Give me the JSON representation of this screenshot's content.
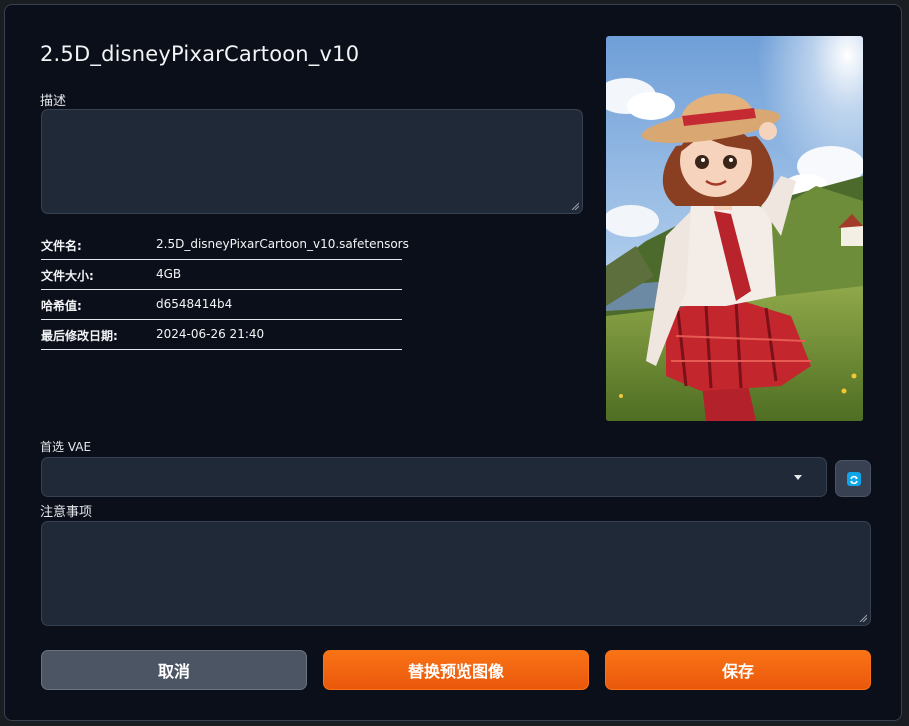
{
  "dialog": {
    "title": "2.5D_disneyPixarCartoon_v10",
    "description_label": "描述",
    "description_value": "",
    "info": [
      {
        "key": "文件名:",
        "value": "2.5D_disneyPixarCartoon_v10.safetensors"
      },
      {
        "key": "文件大小:",
        "value": "4GB"
      },
      {
        "key": "哈希值:",
        "value": "d6548414b4"
      },
      {
        "key": "最后修改日期:",
        "value": "2024-06-26 21:40"
      }
    ],
    "vae_label": "首选 VAE",
    "vae_value": "",
    "notes_label": "注意事项",
    "notes_value": "",
    "buttons": {
      "cancel": "取消",
      "replace_preview": "替换预览图像",
      "save": "保存"
    }
  },
  "colors": {
    "background": "#0b0f19",
    "field": "#1f2937",
    "accent": "#f97316",
    "cancel": "#4b5563",
    "refresh": "#0ea5e9"
  },
  "icons": {
    "refresh": "refresh-icon",
    "dropdown": "chevron-down-icon",
    "resize": "resize-grip-icon"
  }
}
